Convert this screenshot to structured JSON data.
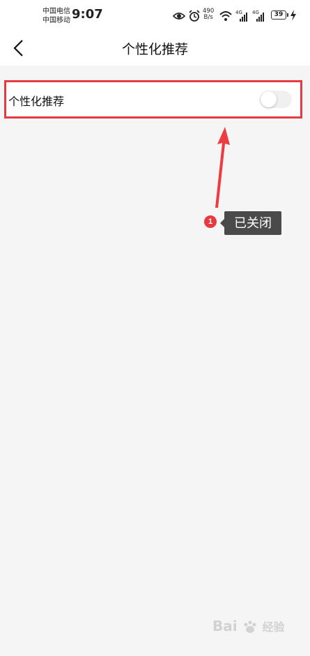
{
  "status_bar": {
    "carrier_1": "中国电信",
    "carrier_2": "中国移动",
    "time": "9:07",
    "net_speed_value": "490",
    "net_speed_unit": "B/s",
    "battery": "39",
    "signal_1_label": "4G",
    "signal_2_label": "4G",
    "icons": [
      "eye-icon",
      "alarm-icon",
      "wifi-icon",
      "signal-icon",
      "signal-icon",
      "battery-icon",
      "charging-icon"
    ]
  },
  "header": {
    "title": "个性化推荐",
    "back_icon": "chevron-left-icon"
  },
  "settings": {
    "personalized_recommendation": {
      "label": "个性化推荐",
      "enabled": false
    }
  },
  "annotation": {
    "badge_number": "1",
    "callout_text": "已关闭",
    "color": "#e8393f"
  },
  "watermark": {
    "text_1": "Bai",
    "text_2": "经验"
  }
}
